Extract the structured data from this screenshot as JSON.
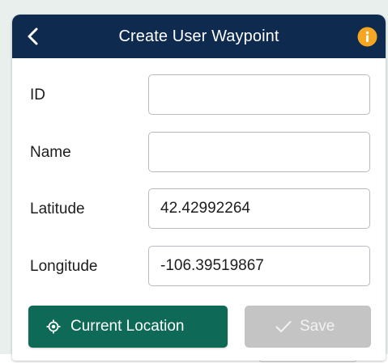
{
  "dialog": {
    "title": "Create User Waypoint",
    "back_icon": "chevron-left-icon",
    "info_icon": "info-icon",
    "info_color": "#f5a623",
    "header_color": "#0e2a4f"
  },
  "form": {
    "fields": [
      {
        "label": "ID",
        "value": ""
      },
      {
        "label": "Name",
        "value": ""
      },
      {
        "label": "Latitude",
        "value": "42.42992264"
      },
      {
        "label": "Longitude",
        "value": "-106.39519867"
      }
    ]
  },
  "actions": {
    "current_location_label": "Current Location",
    "current_location_icon": "location-target-icon",
    "current_location_color": "#0e6a57",
    "save_label": "Save",
    "save_icon": "checkmark-icon",
    "save_enabled": false
  }
}
